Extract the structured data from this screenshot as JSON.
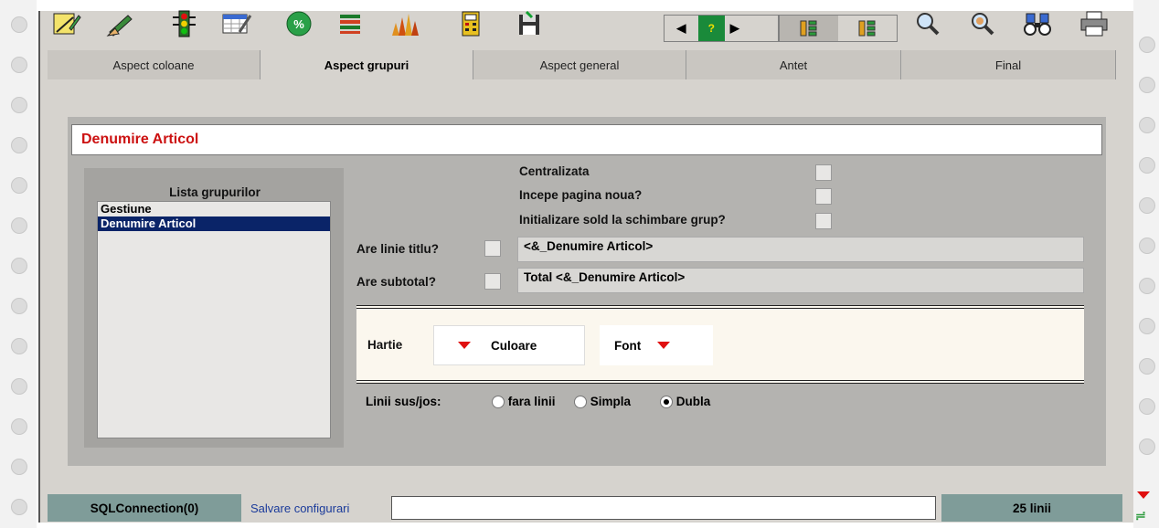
{
  "toolbar": {
    "icons": [
      "edit-form-icon",
      "pencil-hand-icon",
      "traffic-light-icon",
      "edit-grid-icon",
      "percent-icon",
      "list-lines-icon",
      "bar-chart-icon",
      "calculator-icon",
      "save-disk-icon"
    ],
    "nav_help": "?",
    "right_icons": [
      "zoom-in-icon",
      "zoom-out-icon",
      "binoculars-icon",
      "printer-icon"
    ]
  },
  "tabs": [
    {
      "label": "Aspect coloane",
      "active": false
    },
    {
      "label": "Aspect grupuri",
      "active": true
    },
    {
      "label": "Aspect general",
      "active": false
    },
    {
      "label": "Antet",
      "active": false
    },
    {
      "label": "Final",
      "active": false
    }
  ],
  "title": "Denumire Articol",
  "groups": {
    "heading": "Lista grupurilor",
    "items": [
      {
        "label": "Gestiune",
        "selected": false
      },
      {
        "label": "Denumire Articol",
        "selected": true
      }
    ]
  },
  "options": {
    "centralizata": "Centralizata",
    "pagina_noua": "Incepe pagina noua?",
    "initializare_sold": "Initializare sold la schimbare grup?",
    "linie_titlu": "Are linie titlu?",
    "linie_titlu_value": "<&_Denumire Articol>",
    "subtotal": "Are subtotal?",
    "subtotal_value": "Total <&_Denumire Articol>"
  },
  "style_box": {
    "hartie": "Hartie",
    "culoare": "Culoare",
    "font": "Font"
  },
  "lines": {
    "label": "Linii sus/jos:",
    "options": [
      "fara linii",
      "Simpla",
      "Dubla"
    ],
    "selected": "Dubla"
  },
  "status": {
    "connection": "SQLConnection(0)",
    "save_label": "Salvare configurari",
    "save_value": "",
    "lines_count": "25 linii"
  },
  "colors": {
    "accent_red": "#cc1111",
    "selection": "#0a2468",
    "status_bg": "#7f9c99"
  }
}
